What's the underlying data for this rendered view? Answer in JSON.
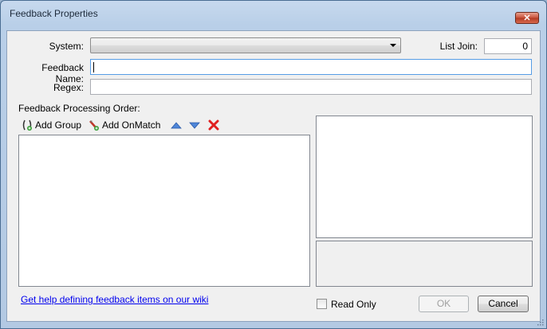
{
  "window": {
    "title": "Feedback Properties",
    "close_glyph": "✕"
  },
  "form": {
    "system_label": "System:",
    "system_value": "",
    "list_join_label": "List Join:",
    "list_join_value": "0",
    "feedback_name_label": "Feedback Name:",
    "feedback_name_value": "",
    "regex_label": "Regex:",
    "regex_value": "",
    "processing_order_label": "Feedback Processing Order:"
  },
  "toolbar": {
    "add_group_label": "Add Group",
    "add_onmatch_label": "Add OnMatch"
  },
  "footer": {
    "help_link": "Get help defining feedback items on our wiki",
    "read_only_label": "Read Only",
    "read_only_checked": false,
    "ok_label": "OK",
    "cancel_label": "Cancel"
  },
  "colors": {
    "accent_blue": "#3b6fcf",
    "delete_red": "#e02020"
  }
}
